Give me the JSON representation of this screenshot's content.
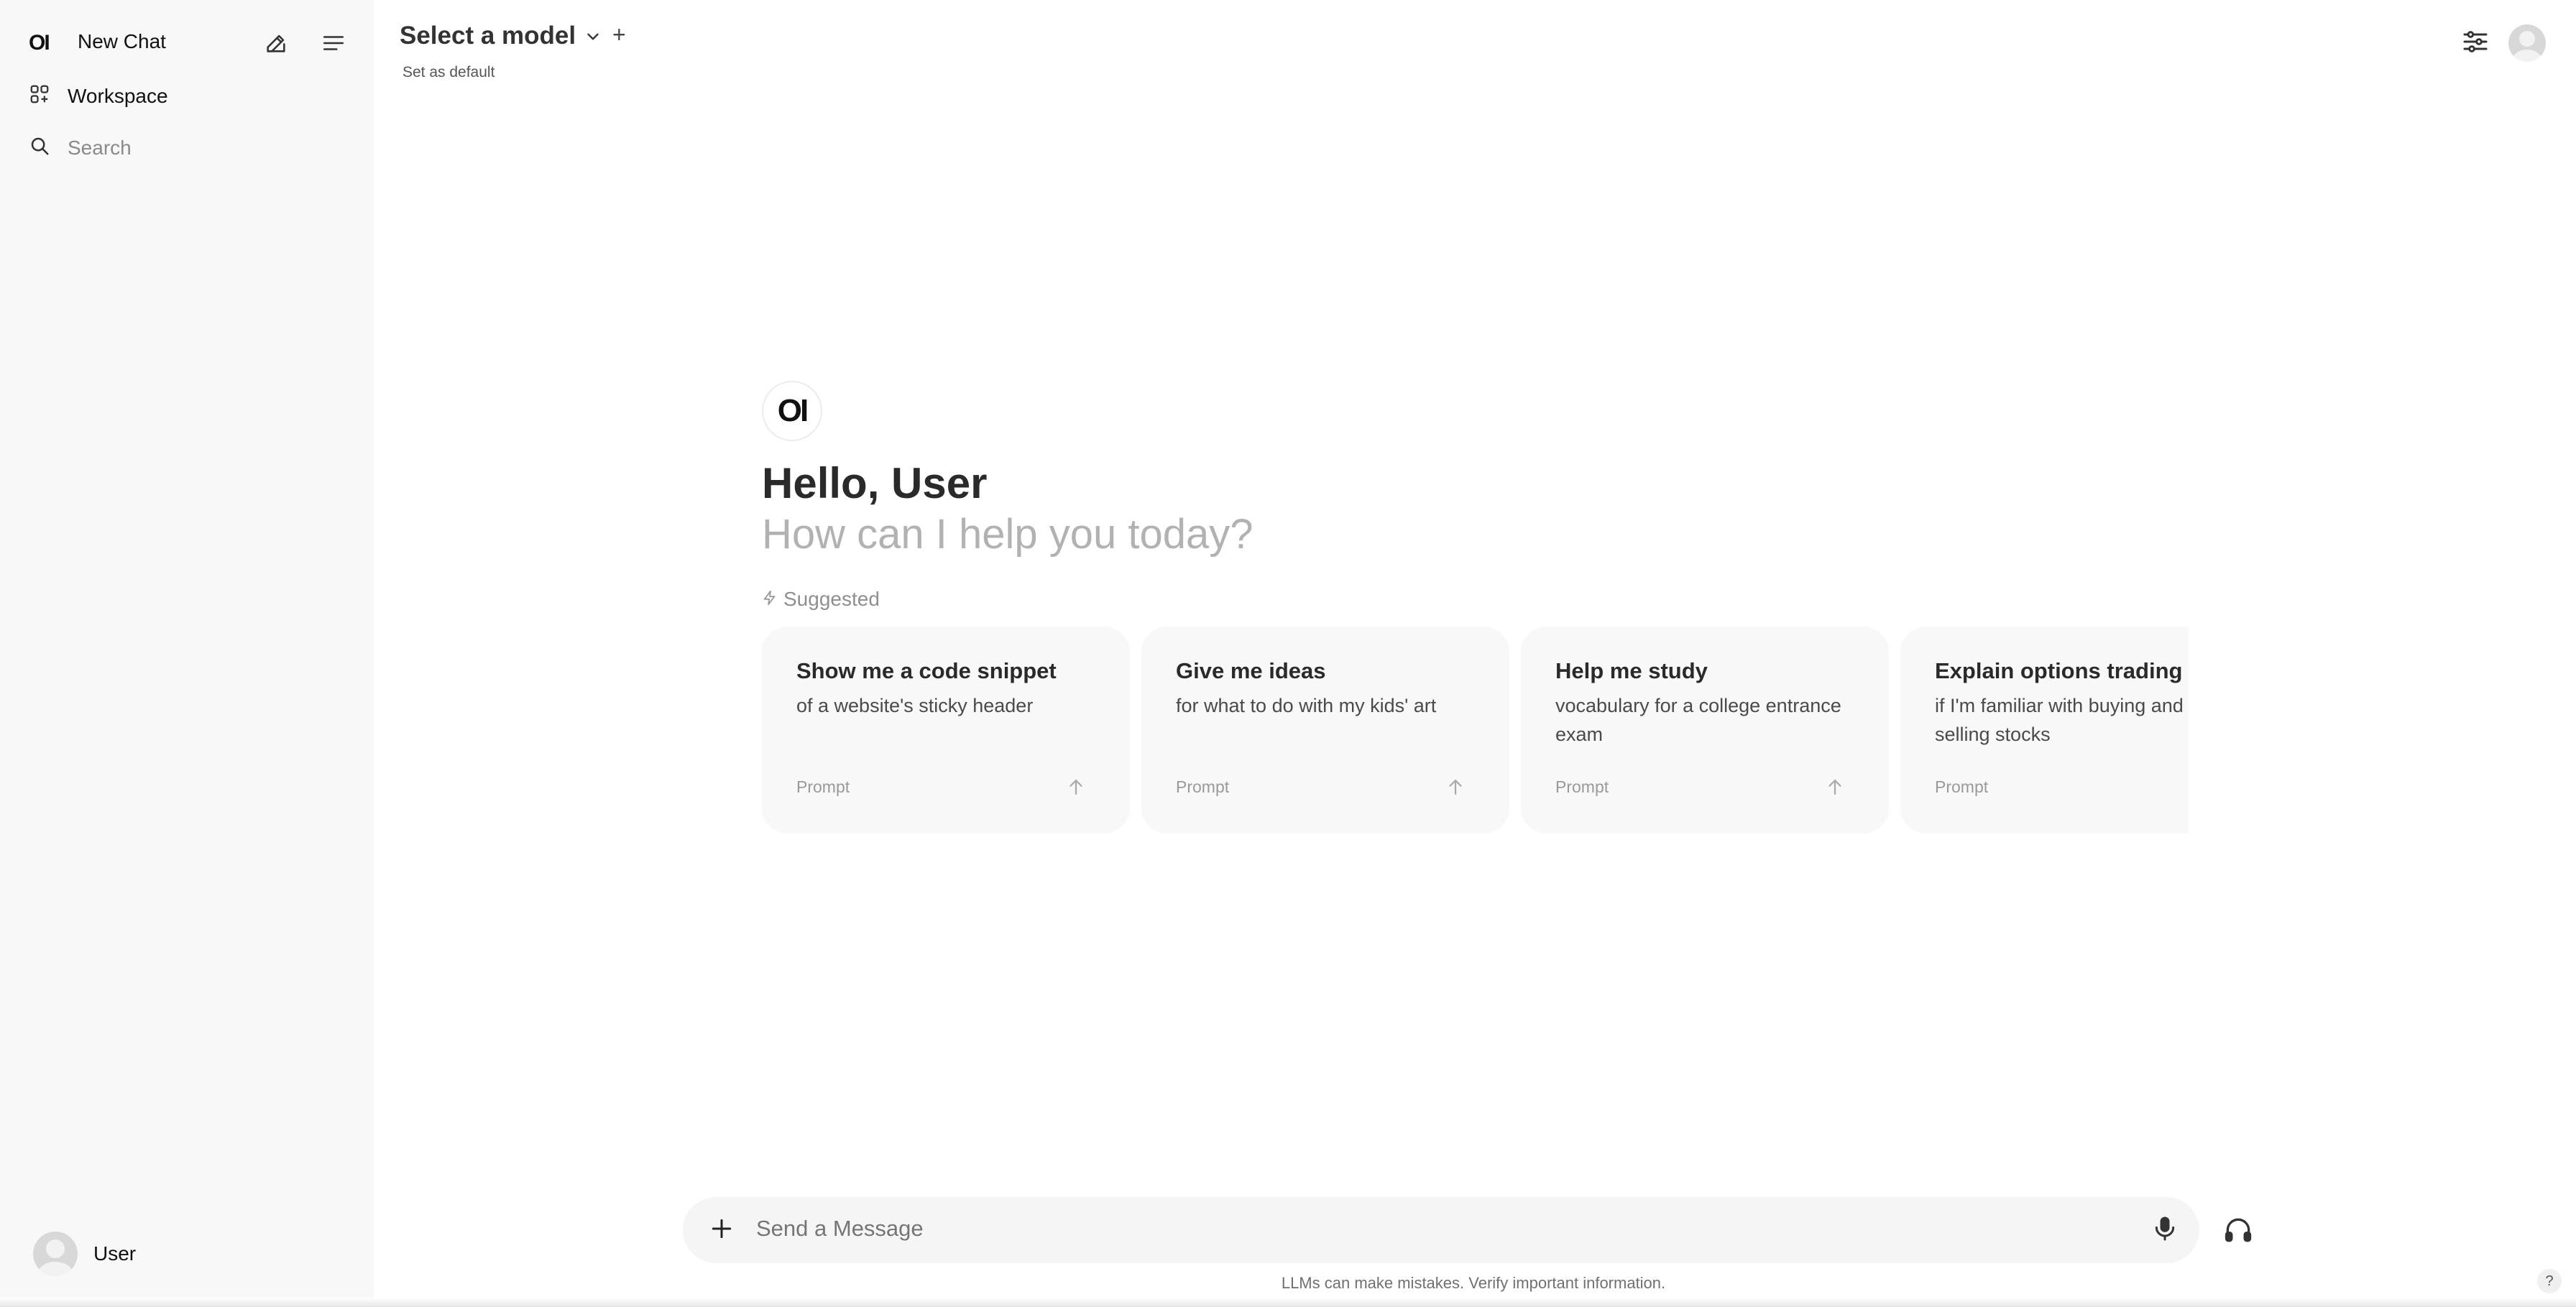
{
  "sidebar": {
    "logo_text": "OI",
    "new_chat_label": "New Chat",
    "items": [
      {
        "label": "Workspace",
        "icon": "workspace-grid-icon"
      },
      {
        "label": "Search",
        "icon": "search-icon"
      }
    ],
    "user_name": "User"
  },
  "header": {
    "model_title": "Select a model",
    "set_default": "Set as default",
    "plus_symbol": "+"
  },
  "hero": {
    "logo_text": "OI",
    "greeting": "Hello, User",
    "subtitle": "How can I help you today?",
    "suggested_label": "Suggested"
  },
  "suggestions": [
    {
      "title": "Show me a code snippet",
      "desc": "of a website's sticky header",
      "prompt": "Prompt"
    },
    {
      "title": "Give me ideas",
      "desc": "for what to do with my kids' art",
      "prompt": "Prompt"
    },
    {
      "title": "Help me study",
      "desc": "vocabulary for a college entrance exam",
      "prompt": "Prompt"
    },
    {
      "title": "Explain options trading",
      "desc": "if I'm familiar with buying and selling stocks",
      "prompt": "Prompt"
    }
  ],
  "composer": {
    "placeholder": "Send a Message"
  },
  "footer": {
    "disclaimer": "LLMs can make mistakes. Verify important information.",
    "help": "?"
  }
}
